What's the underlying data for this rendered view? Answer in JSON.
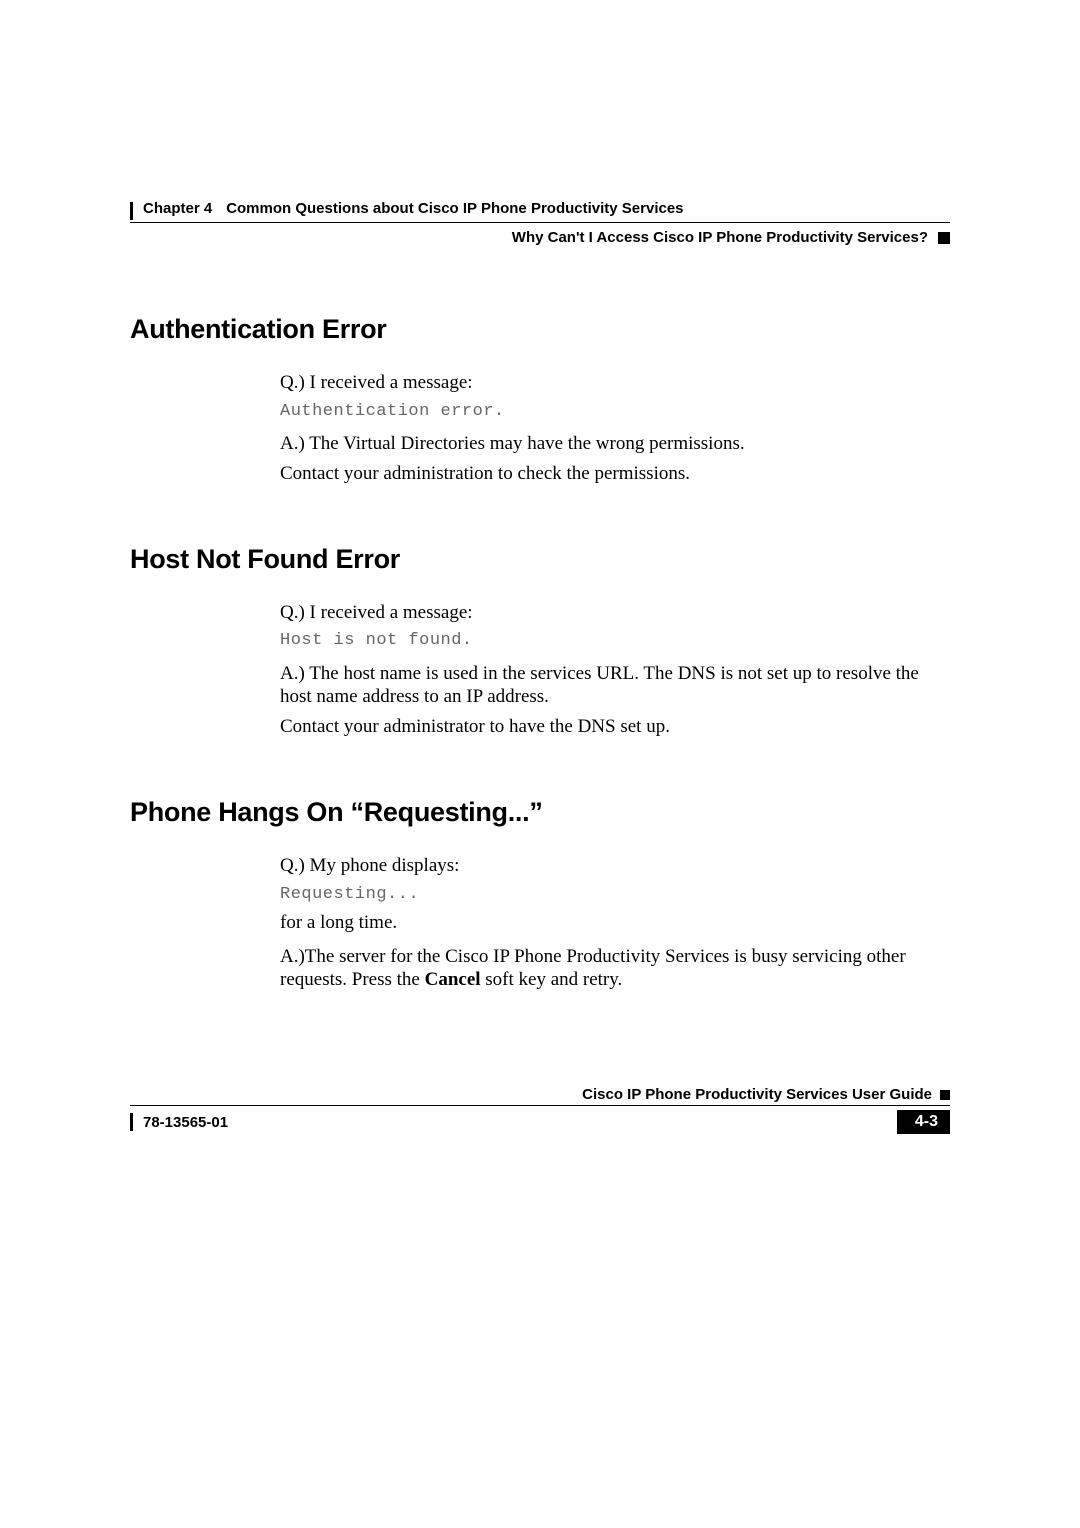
{
  "header": {
    "chapter_label": "Chapter 4",
    "chapter_title": "Common Questions about Cisco IP Phone Productivity Services",
    "subhead": "Why Can't I Access Cisco IP Phone Productivity Services?"
  },
  "sections": [
    {
      "heading": "Authentication Error",
      "q_intro": "Q.) I received a message:",
      "code": "Authentication error.",
      "a1": "A.) The Virtual Directories may have the wrong permissions.",
      "a2": "Contact your administration to check the permissions."
    },
    {
      "heading": "Host Not Found Error",
      "q_intro": "Q.) I received a message:",
      "code": "Host is not found.",
      "a1": "A.) The host name is used in the services URL. The DNS is not set up to resolve the host name address to an IP address.",
      "a2": "Contact your administrator to have the DNS set up."
    },
    {
      "heading": "Phone Hangs On “Requesting...”",
      "q_intro": "Q.) My phone displays:",
      "code": "Requesting...",
      "post_code": "for a long time.",
      "a_prefix": "A.)The server for the Cisco IP Phone Productivity Services is busy servicing other requests. Press the ",
      "a_bold": "Cancel",
      "a_suffix": " soft key and retry."
    }
  ],
  "footer": {
    "guide": "Cisco IP Phone Productivity Services User Guide",
    "docnum": "78-13565-01",
    "pagenum": "4-3"
  }
}
